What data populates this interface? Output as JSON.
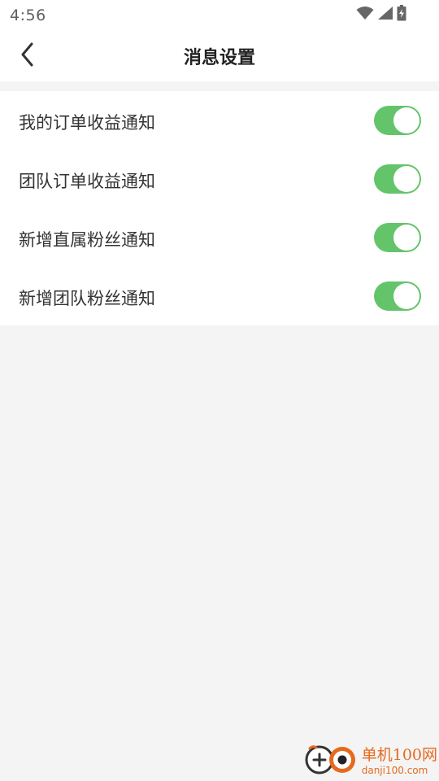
{
  "status_bar": {
    "time": "4:56",
    "icons": [
      "wifi-icon",
      "cellular-signal-icon",
      "battery-charging-icon"
    ]
  },
  "nav": {
    "back_icon": "chevron-left-icon",
    "title": "消息设置"
  },
  "settings": [
    {
      "label": "我的订单收益通知",
      "enabled": true
    },
    {
      "label": "团队订单收益通知",
      "enabled": true
    },
    {
      "label": "新增直属粉丝通知",
      "enabled": true
    },
    {
      "label": "新增团队粉丝通知",
      "enabled": true
    }
  ],
  "watermark": {
    "name": "单机100网",
    "url": "danji100.com"
  },
  "colors": {
    "toggle_on": "#64c46a",
    "background": "#f4f4f4",
    "watermark": "#e56a1f"
  }
}
